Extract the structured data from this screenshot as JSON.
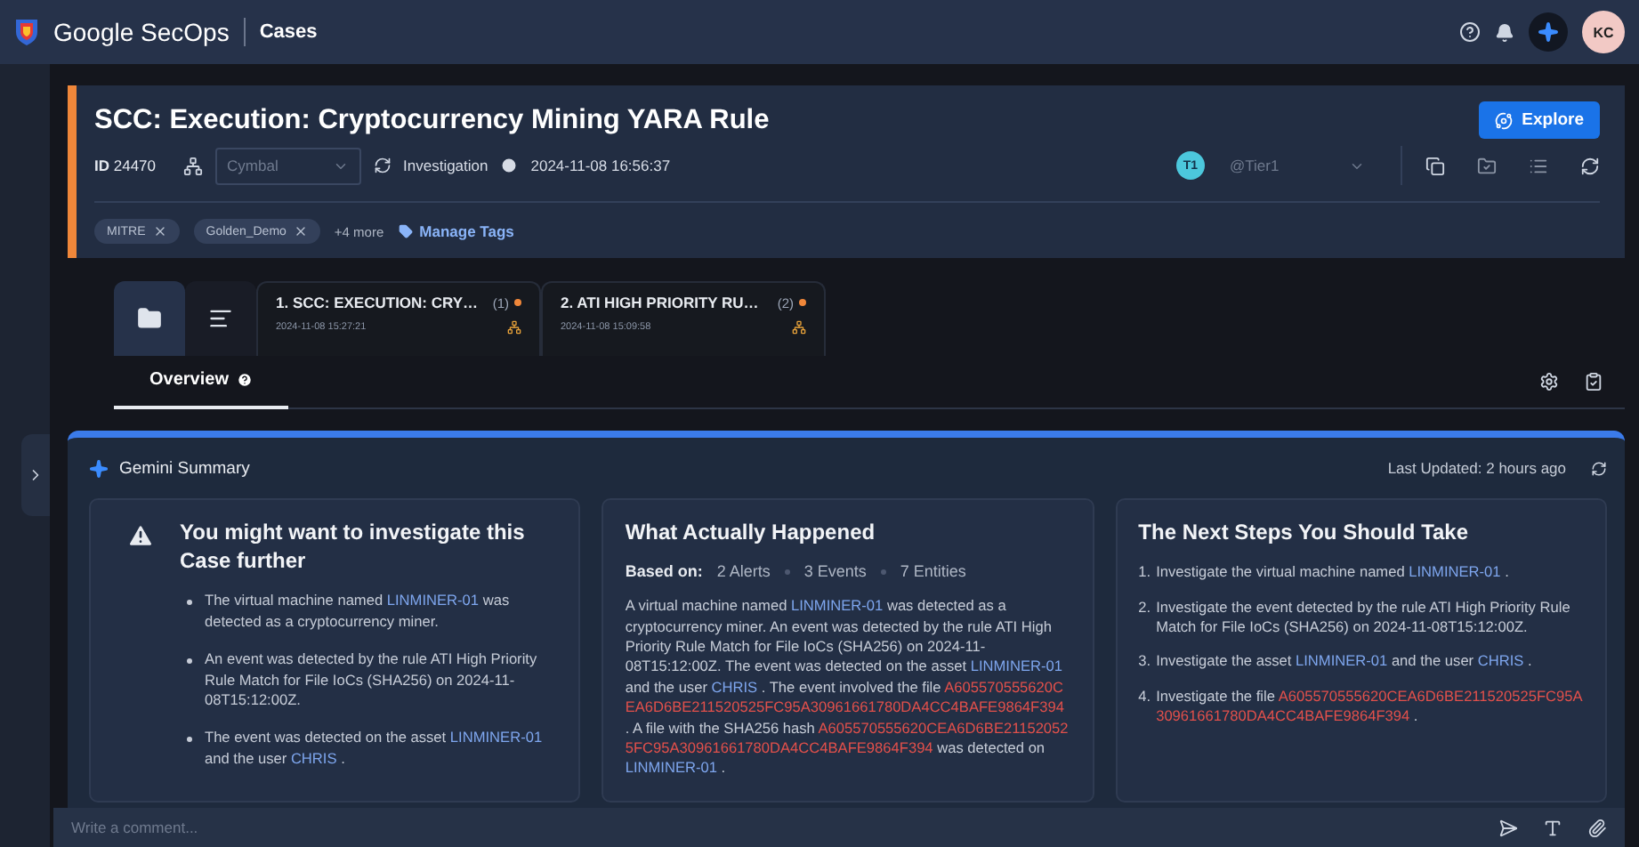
{
  "topbar": {
    "product": "Google SecOps",
    "section": "Cases",
    "avatar": "KC"
  },
  "case": {
    "title": "SCC: Execution: Cryptocurrency Mining YARA Rule",
    "id_label": "ID",
    "id": "24470",
    "environment": "Cymbal",
    "stage": "Investigation",
    "time": "2024-11-08 16:56:37",
    "assignee_badge": "T1",
    "assignee": "@Tier1",
    "explore": "Explore",
    "tags": [
      {
        "label": "MITRE"
      },
      {
        "label": "Golden_Demo"
      }
    ],
    "more_tags": "+4 more",
    "manage_tags": "Manage Tags"
  },
  "view_buttons": [
    {
      "kind": "folder",
      "selected": true
    },
    {
      "kind": "list",
      "selected": false
    }
  ],
  "alert_tabs": [
    {
      "title": "1. SCC: EXECUTION: CRY…",
      "count": "(1)",
      "time": "2024-11-08 15:27:21"
    },
    {
      "title": "2. ATI HIGH PRIORITY RU…",
      "count": "(2)",
      "time": "2024-11-08 15:09:58"
    }
  ],
  "detail_tabs": [
    {
      "label": "Overview",
      "selected": true
    }
  ],
  "gemini": {
    "title": "Gemini Summary",
    "updated": "Last Updated: 2 hours ago",
    "cards": [
      {
        "kind": "bullets",
        "title": "You might want to investigate this Case further",
        "items": [
          [
            {
              "text": "The virtual machine named ",
              "kind": "plain"
            },
            {
              "text": "LINMINER-01",
              "kind": "entity"
            },
            {
              "text": " was detected as a cryptocurrency miner.",
              "kind": "plain"
            }
          ],
          [
            {
              "text": "An event was detected by the rule ATI High Priority Rule Match for File IoCs (SHA256) on 2024-11-08T15:12:00Z.",
              "kind": "plain"
            }
          ],
          [
            {
              "text": "The event was detected on the asset ",
              "kind": "plain"
            },
            {
              "text": "LINMINER-01",
              "kind": "entity"
            },
            {
              "text": " and the user ",
              "kind": "plain"
            },
            {
              "text": "CHRIS",
              "kind": "entity"
            },
            {
              "text": " .",
              "kind": "plain"
            }
          ]
        ]
      },
      {
        "kind": "paragraph",
        "title": "What Actually Happened",
        "based_on": "Based on:",
        "stats": [
          "2 Alerts",
          "3 Events",
          "7 Entities"
        ],
        "body": [
          {
            "text": "A virtual machine named ",
            "kind": "plain"
          },
          {
            "text": "LINMINER-01",
            "kind": "entity"
          },
          {
            "text": " was detected as a cryptocurrency miner. An event was detected by the rule ATI High Priority Rule Match for File IoCs (SHA256) on 2024-11-08T15:12:00Z. The event was detected on the asset ",
            "kind": "plain"
          },
          {
            "text": "LINMINER-01",
            "kind": "entity"
          },
          {
            "text": " and the user ",
            "kind": "plain"
          },
          {
            "text": "CHRIS",
            "kind": "entity"
          },
          {
            "text": " . The event involved the file ",
            "kind": "plain"
          },
          {
            "text": "A605570555620CEA6D6BE211520525FC95A30961661780DA4CC4BAFE9864F394",
            "kind": "hash"
          },
          {
            "text": " . A file with the SHA256 hash ",
            "kind": "plain"
          },
          {
            "text": "A605570555620CEA6D6BE211520525FC95A30961661780DA4CC4BAFE9864F394",
            "kind": "hash"
          },
          {
            "text": " was detected on ",
            "kind": "plain"
          },
          {
            "text": "LINMINER-01",
            "kind": "entity"
          },
          {
            "text": " .",
            "kind": "plain"
          }
        ]
      },
      {
        "kind": "numbered",
        "title": "The Next Steps You Should Take",
        "items": [
          {
            "number": "1.",
            "parts": [
              {
                "text": "Investigate the virtual machine named ",
                "kind": "plain"
              },
              {
                "text": "LINMINER-01",
                "kind": "entity"
              },
              {
                "text": " .",
                "kind": "plain"
              }
            ]
          },
          {
            "number": "2.",
            "parts": [
              {
                "text": "Investigate the event detected by the rule ATI High Priority Rule Match for File IoCs (SHA256) on 2024-11-08T15:12:00Z.",
                "kind": "plain"
              }
            ]
          },
          {
            "number": "3.",
            "parts": [
              {
                "text": "Investigate the asset ",
                "kind": "plain"
              },
              {
                "text": "LINMINER-01",
                "kind": "entity"
              },
              {
                "text": " and the user ",
                "kind": "plain"
              },
              {
                "text": "CHRIS",
                "kind": "entity"
              },
              {
                "text": " .",
                "kind": "plain"
              }
            ]
          },
          {
            "number": "4.",
            "parts": [
              {
                "text": "Investigate the file ",
                "kind": "plain"
              },
              {
                "text": "A605570555620CEA6D6BE211520525FC95A30961661780DA4CC4BAFE9864F394",
                "kind": "hash"
              },
              {
                "text": " .",
                "kind": "plain"
              }
            ]
          }
        ]
      }
    ]
  },
  "comment": {
    "placeholder": "Write a comment..."
  }
}
